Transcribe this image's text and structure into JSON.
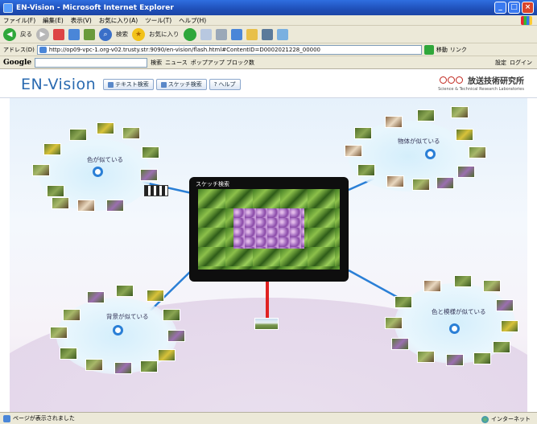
{
  "window": {
    "title": "EN-Vision - Microsoft Internet Explorer",
    "controls": [
      "_",
      "□",
      "×"
    ]
  },
  "menubar": {
    "items": [
      "ファイル(F)",
      "編集(E)",
      "表示(V)",
      "お気に入り(A)",
      "ツール(T)",
      "ヘルプ(H)"
    ]
  },
  "toolbar": {
    "back_label": "戻る",
    "search_label": "検索",
    "favorites_label": "お気に入り"
  },
  "addressbar": {
    "label": "アドレス(D)",
    "url": "http://op09-vpc-1.org-v02.trusty.str:9090/en-vision/flash.html#ContentID=D0002021228_00000",
    "go_label": "移動",
    "links_label": "リンク"
  },
  "googlebar": {
    "logo": "Google",
    "search_label": "検索",
    "news_label": "ニュース",
    "popup_label": "ポップアップ ブロック数",
    "settings_label": "設定",
    "login_label": "ログイン"
  },
  "app": {
    "brand": "EN-Vision",
    "nav": {
      "text_search": "テキスト検索",
      "sketch_search": "スケッチ検索",
      "help": "ヘルプ"
    },
    "org_name": "放送技術研究所",
    "org_sub": "Science & Technical Research Laboratories",
    "clusters": {
      "top_left": "色が似ている",
      "top_right": "物体が似ている",
      "bottom_left": "背景が似ている",
      "bottom_right": "色と模様が似ている"
    },
    "sketch_panel_title": "スケッチ検索"
  },
  "statusbar": {
    "message": "ページが表示されました",
    "zone": "インターネット"
  },
  "colors": {
    "title_bar": "#1f4fb8",
    "brand_text": "#2a6ab0",
    "node_stroke": "#2a7fd6",
    "stem": "#e02222",
    "panel_bg": "#0e0e0e"
  }
}
